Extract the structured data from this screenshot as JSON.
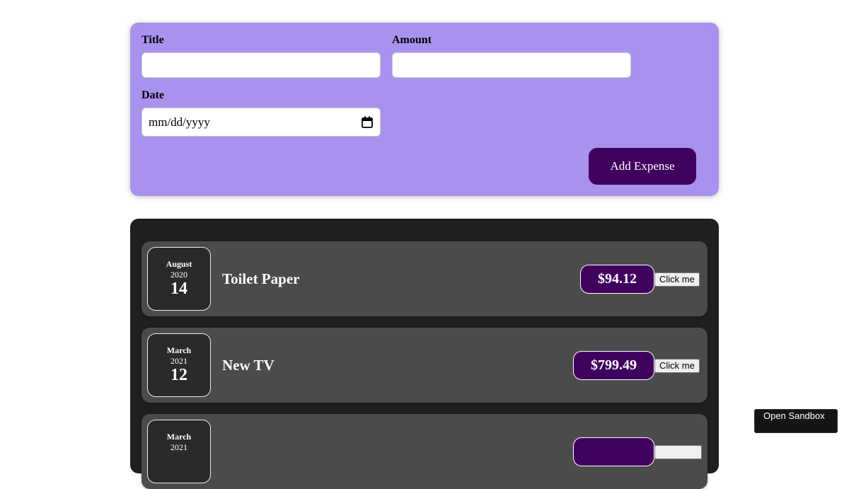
{
  "form": {
    "title_label": "Title",
    "title_value": "",
    "amount_label": "Amount",
    "amount_value": "",
    "date_label": "Date",
    "date_placeholder": "mm/dd/yyyy",
    "submit_label": "Add Expense"
  },
  "expenses": [
    {
      "month": "August",
      "year": "2020",
      "day": "14",
      "title": "Toilet Paper",
      "amount": "$94.12",
      "action_label": "Click me"
    },
    {
      "month": "March",
      "year": "2021",
      "day": "12",
      "title": "New TV",
      "amount": "$799.49",
      "action_label": "Click me"
    },
    {
      "month": "March",
      "year": "2021",
      "day": "",
      "title": "",
      "amount": "",
      "action_label": ""
    }
  ],
  "sandbox": {
    "label": "Open Sandbox"
  },
  "colors": {
    "form_bg": "#a892ee",
    "accent": "#40005d",
    "list_bg": "#1f1f1f",
    "item_bg": "#4b4b4b"
  }
}
